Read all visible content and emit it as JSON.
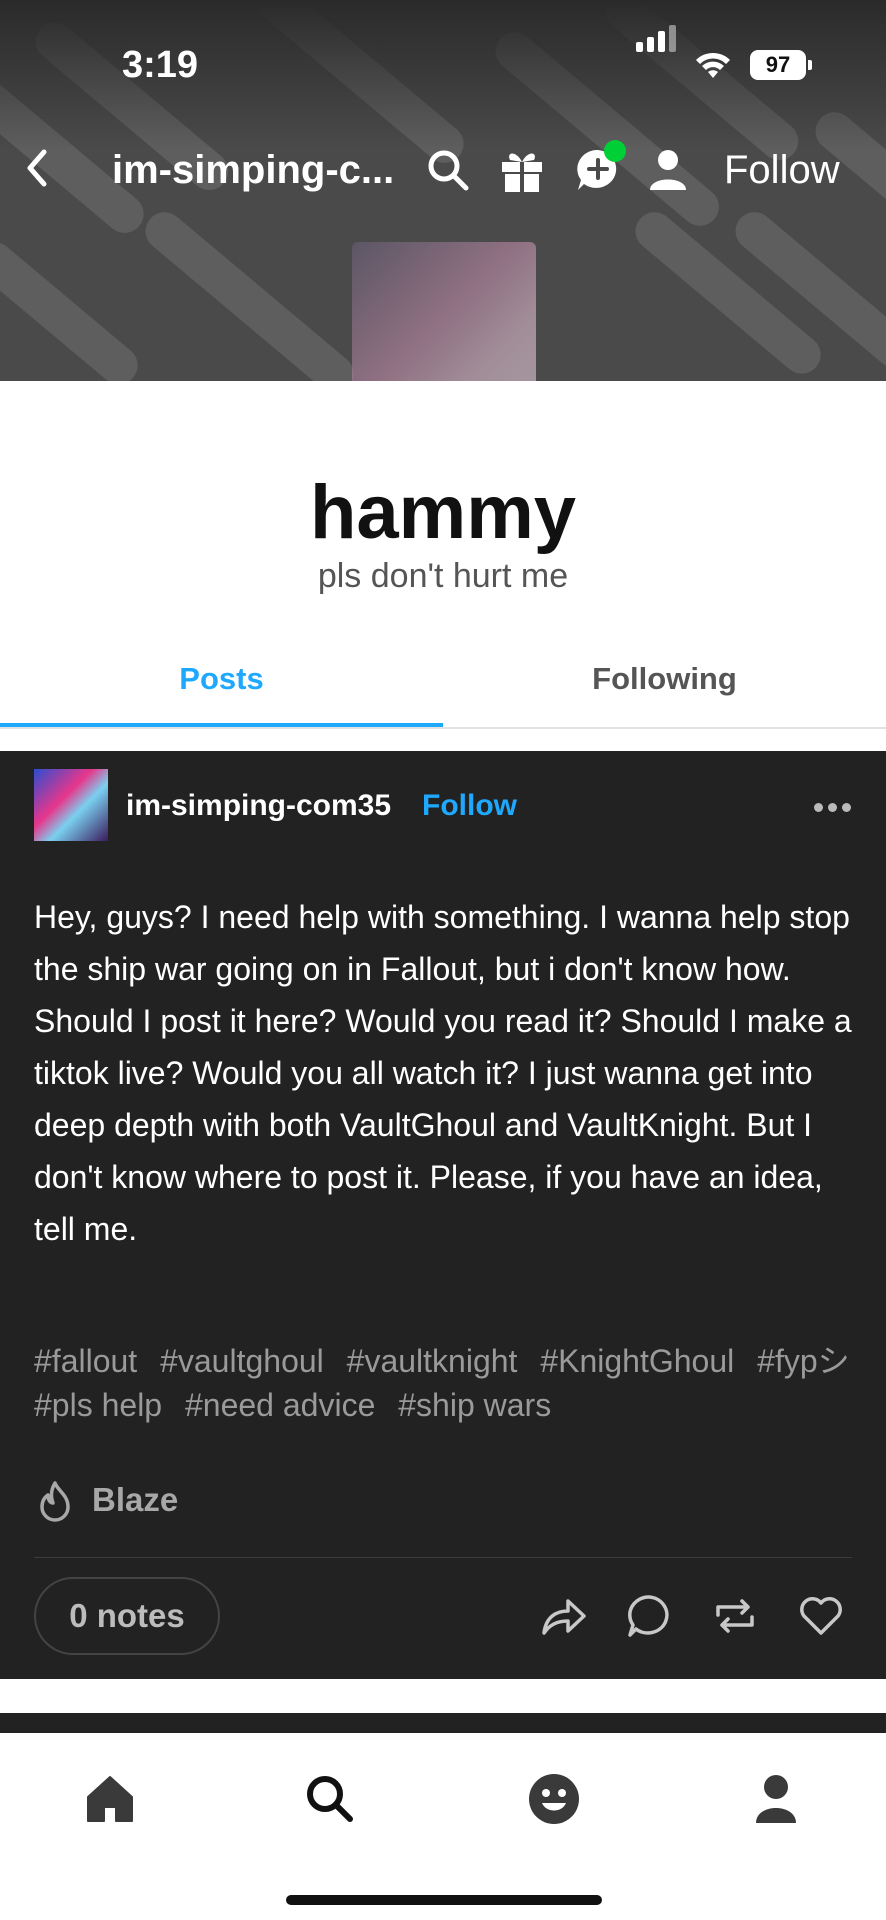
{
  "status_bar": {
    "time": "3:19",
    "battery": "97"
  },
  "nav": {
    "blog_url": "im-simping-c...",
    "follow_label": "Follow",
    "icons": [
      "back-icon",
      "search-icon",
      "gift-icon",
      "chat-add-icon",
      "person-icon"
    ]
  },
  "profile": {
    "title": "hammy",
    "description": "pls don't hurt me"
  },
  "tabs": {
    "posts": "Posts",
    "following": "Following"
  },
  "post": {
    "author": "im-simping-com35",
    "follow_label": "Follow",
    "body": "Hey, guys? I need help with something. I wanna help stop the ship war going on in Fallout, but i don't know how. Should I post it here? Would you read it? Should I make a tiktok live? Would you all watch it? I just wanna get into deep depth with both VaultGhoul and VaultKnight. But I don't know where to post it. Please, if you have an idea, tell me.",
    "tags": [
      "#fallout",
      "#vaultghoul",
      "#vaultknight",
      "#KnightGhoul",
      "#fypシ",
      "#pls help",
      "#need advice",
      "#ship wars"
    ],
    "blaze_label": "Blaze",
    "notes_label": "0 notes"
  },
  "bottom_tabs": [
    "home-icon",
    "search-icon",
    "activity-icon",
    "profile-icon"
  ],
  "colors": {
    "accent": "#1ea9ff",
    "post_bg": "#222222",
    "online_dot": "#00cf35"
  }
}
